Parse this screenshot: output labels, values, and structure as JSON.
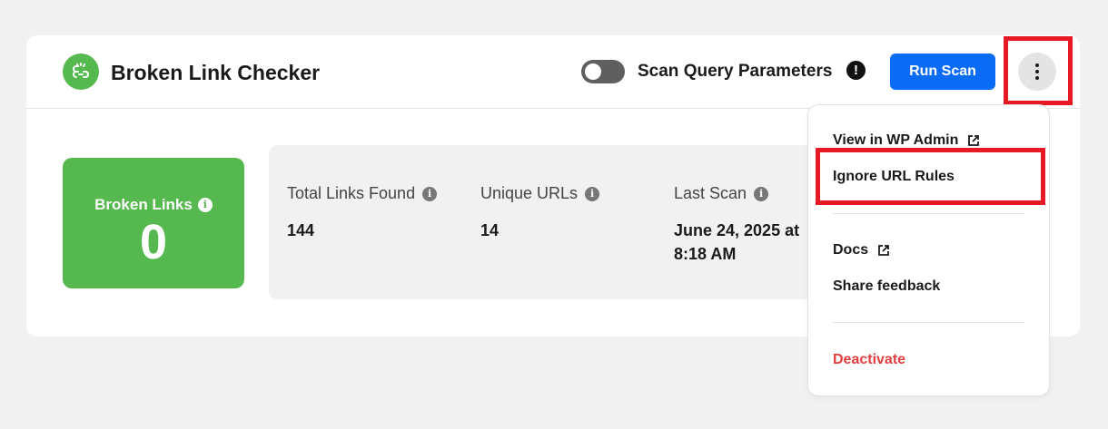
{
  "header": {
    "title": "Broken Link Checker",
    "toggle_label": "Scan Query Parameters",
    "toggle_on": false,
    "warning_glyph": "!",
    "run_scan_label": "Run Scan"
  },
  "summary": {
    "broken_links_label": "Broken Links",
    "broken_links_count": "0"
  },
  "stats": [
    {
      "label": "Total Links Found",
      "value": "144"
    },
    {
      "label": "Unique URLs",
      "value": "14"
    },
    {
      "label": "Last Scan",
      "value": "June 24, 2025 at 8:18 AM"
    }
  ],
  "menu": {
    "items": [
      {
        "label": "View in WP Admin",
        "external": true
      },
      {
        "label": "Ignore URL Rules",
        "external": false
      },
      {
        "label": "Docs",
        "external": true
      },
      {
        "label": "Share feedback",
        "external": false
      },
      {
        "label": "Deactivate",
        "external": false
      }
    ]
  },
  "colors": {
    "brand_green": "#56b94f",
    "primary_blue": "#0a6cf5",
    "danger_red": "#e43d3d",
    "annotation_red": "#e61925"
  },
  "icons": {
    "logo": "broken-link-icon",
    "warning": "exclamation-icon",
    "info": "info-icon",
    "external": "external-link-icon",
    "menu": "kebab-icon"
  }
}
